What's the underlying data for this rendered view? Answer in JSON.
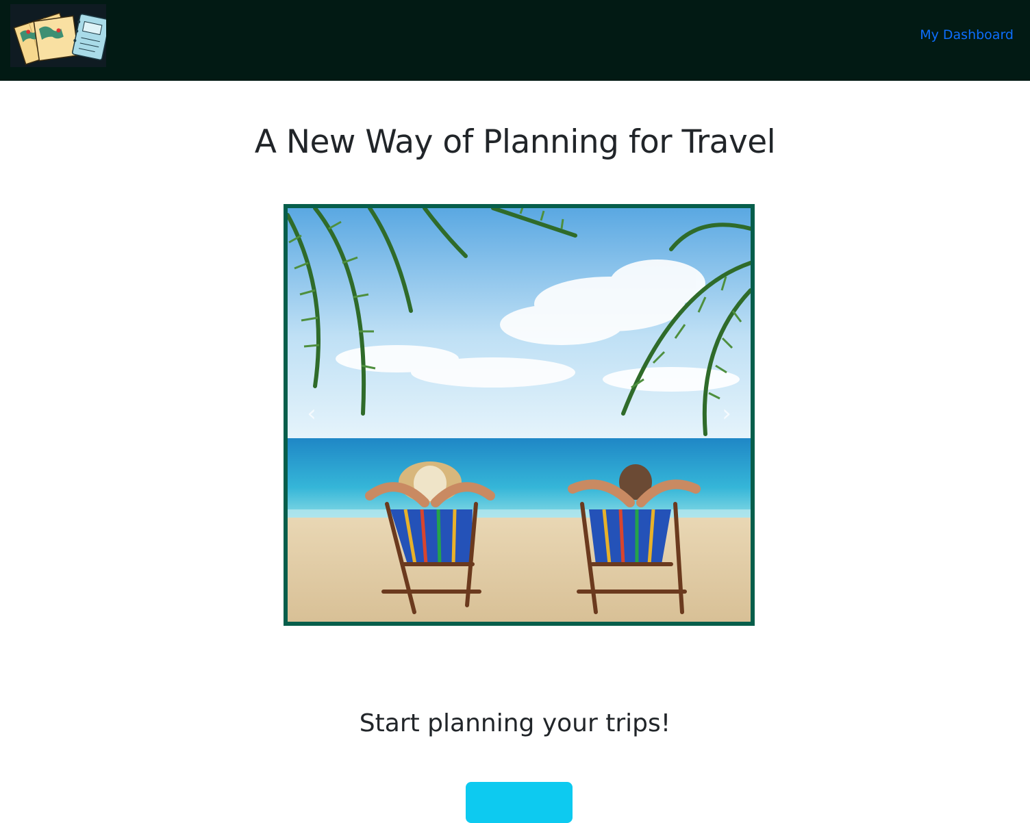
{
  "navbar": {
    "logo_icon": "travel-maps-notebook-logo",
    "dashboard_link": "My Dashboard",
    "background": "#021a14",
    "link_color": "#0d6efd"
  },
  "hero": {
    "title": "A New Way of Planning for Travel"
  },
  "carousel": {
    "image_subject": "beach-loungers-palm-trees",
    "prev_icon": "‹",
    "next_icon": "›",
    "border_color": "#075e4b"
  },
  "cta_section": {
    "heading": "Start planning your trips!",
    "button_label": "",
    "button_color": "#0dcaf0"
  }
}
